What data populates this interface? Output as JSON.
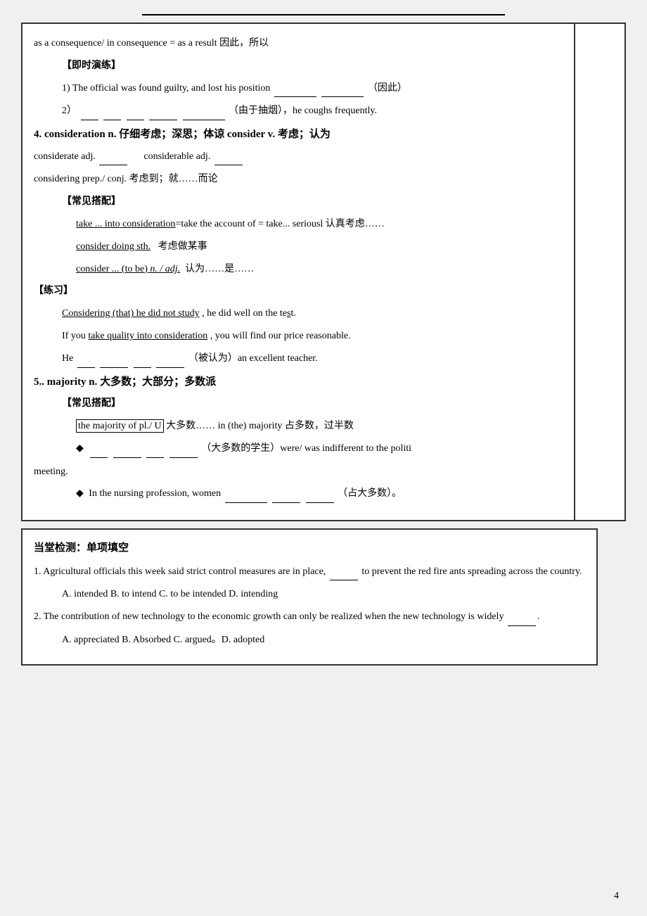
{
  "page": {
    "page_number": "4",
    "top_line_text": "",
    "main_section": {
      "consequence_line": "as a consequence/ in consequence = as a result  因此，所以",
      "practice_header": "【即时演练】",
      "exercise1": "1) The official was found guilty, and lost his position",
      "exercise1_suffix": "（因此）",
      "exercise2": "2）",
      "exercise2_suffix": "（由于抽烟），he coughs frequently.",
      "item4_header": "4. consideration n. 仔细考虑；深思；体谅  consider v. 考虑；认为",
      "item4_considerate": "considerate adj.",
      "item4_considerable": "considerable adj.",
      "item4_considering": "considering prep./ conj. 考虑到；就……而论",
      "collocation_header": "【常见搭配】",
      "colloc1": "take ... into consideration=take the account of = take... seriousl 认真考虑……",
      "colloc2": "consider doing sth.    考虑做某事",
      "colloc3": "consider ... (to be) n. / adj.  认为……是……",
      "practice_header2": "【练习】",
      "ex_p1": "Considering (that) he did not study , he did well on the test.",
      "ex_p2": "If you take quality into consideration , you will find our price reasonable.",
      "ex_p3": "He",
      "ex_p3_suffix": "（被认为）an excellent teacher.",
      "item5_header": "5.. majority n. 大多数；大部分；多数派",
      "colloc_header2": "【常见搭配】",
      "majority_colloc1": "the majority of pl./ U 大多数……  in (the) majority 占多数，过半数",
      "majority_bullet1": "（大多数的学生）were/ was indifferent to the politi",
      "majority_bullet1_suffix": "meeting.",
      "majority_bullet2": "In the nursing profession, women",
      "majority_bullet2_suffix": "（占大多数）。"
    },
    "bottom_section": {
      "header": "当堂检测：单项填空",
      "q1_text": "1. Agricultural officials this week said strict control measures are in place,",
      "q1_blank": "________",
      "q1_text2": "to prevent the red fire ants  spreading across the country.",
      "q1_options": "A. intended  B. to intend   C. to be intended  D. intending",
      "q2_text": "2. The contribution of new technology to the economic growth can only be realized when the new technology is widely",
      "q2_blank": "________.",
      "q2_options": "A. appreciated  B. Absorbed    C. argued。D. adopted"
    }
  }
}
